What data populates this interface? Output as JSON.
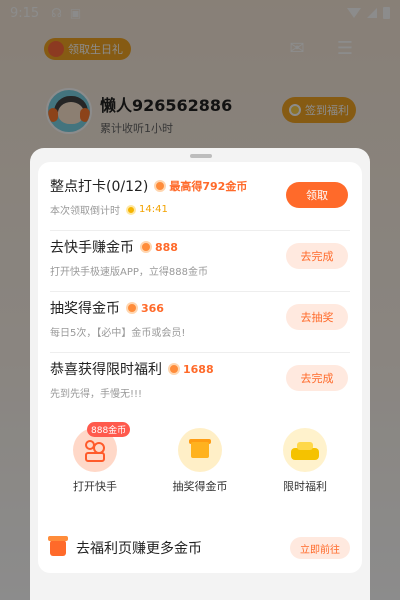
{
  "status_bar": {
    "time": "9:15"
  },
  "header": {
    "birthday_label": "领取生日礼"
  },
  "profile": {
    "name": "懒人926562886",
    "subtitle": "累计收听1小时",
    "sign_in_label": "签到福利"
  },
  "tasks": [
    {
      "title": "整点打卡(0/12)",
      "reward": "最高得792金币",
      "desc": "本次领取倒计时",
      "timer": "14:41",
      "button": "领取"
    },
    {
      "title": "去快手赚金币",
      "reward": "888",
      "desc": "打开快手极速版APP，立得888金币",
      "button": "去完成"
    },
    {
      "title": "抽奖得金币",
      "reward": "366",
      "desc": "每日5次，【必中】金币或会员!",
      "button": "去抽奖"
    },
    {
      "title": "恭喜获得限时福利",
      "reward": "1688",
      "desc": "先到先得，手慢无!!!",
      "button": "去完成"
    }
  ],
  "shortcuts": [
    {
      "label": "打开快手",
      "badge": "888金币"
    },
    {
      "label": "抽奖得金币"
    },
    {
      "label": "限时福利"
    }
  ],
  "promo": {
    "text": "去福利页赚更多金币",
    "button": "立即前往"
  },
  "colors": {
    "accent": "#ff6a2a",
    "accent_light": "#ffe9df",
    "gold": "#f5a623"
  }
}
